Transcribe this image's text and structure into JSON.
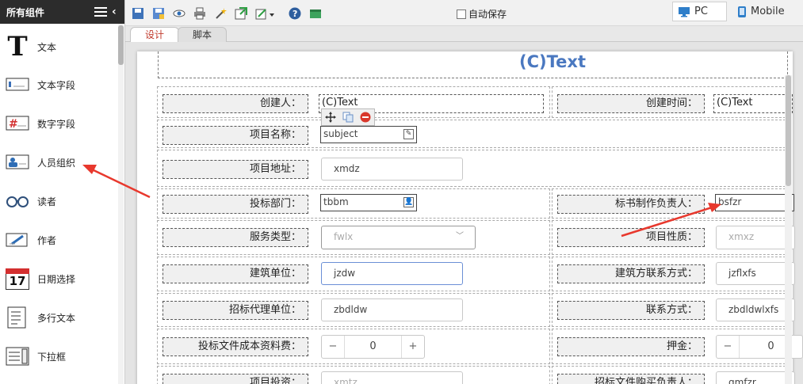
{
  "sidebar": {
    "title": "所有组件",
    "items": [
      {
        "label": "文本",
        "icon": "text-T-icon"
      },
      {
        "label": "文本字段",
        "icon": "text-field-icon"
      },
      {
        "label": "数字字段",
        "icon": "number-field-icon"
      },
      {
        "label": "人员组织",
        "icon": "person-org-icon"
      },
      {
        "label": "读者",
        "icon": "reader-glasses-icon"
      },
      {
        "label": "作者",
        "icon": "author-pen-icon"
      },
      {
        "label": "日期选择",
        "icon": "calendar-icon",
        "badge": "17"
      },
      {
        "label": "多行文本",
        "icon": "multiline-text-icon"
      },
      {
        "label": "下拉框",
        "icon": "dropdown-icon"
      }
    ]
  },
  "toolbar": {
    "autosave_label": "自动保存",
    "pc_label": "PC",
    "mobile_label": "Mobile"
  },
  "tabs": [
    {
      "label": "设计",
      "active": true
    },
    {
      "label": "脚本",
      "active": false
    }
  ],
  "form": {
    "title": "(C)Text",
    "creator_label": "创建人：",
    "creator_value": "(C)Text",
    "created_time_label": "创建时间：",
    "created_time_value": "(C)Text",
    "project_name_label": "项目名称：",
    "project_name_value": "subject",
    "project_address_label": "项目地址：",
    "project_address_value": "xmdz",
    "bid_dept_label": "投标部门：",
    "bid_dept_value": "tbbm",
    "bid_owner_label": "标书制作负责人：",
    "bid_owner_value": "bsfzr",
    "service_type_label": "服务类型：",
    "service_type_value": "fwlx",
    "project_nature_label": "项目性质：",
    "project_nature_value": "xmxz",
    "construction_unit_label": "建筑单位：",
    "construction_unit_value": "jzdw",
    "construction_contact_label": "建筑方联系方式：",
    "construction_contact_value": "jzflxfs",
    "agency_label": "招标代理单位：",
    "agency_value": "zbdldw",
    "contact_label": "联系方式：",
    "contact_value": "zbdldwlxfs",
    "doc_cost_label": "投标文件成本资料费：",
    "doc_cost_value": "0",
    "deposit_label": "押金：",
    "deposit_value": "0",
    "project_invest_label": "项目投资：",
    "project_invest_value": "xmtz",
    "purchase_owner_label": "招标文件购买负责人：",
    "purchase_owner_value": "gmfzr"
  },
  "colors": {
    "title": "#4a78c0",
    "active_tab": "#c0392b",
    "arrow": "#e8382d"
  }
}
